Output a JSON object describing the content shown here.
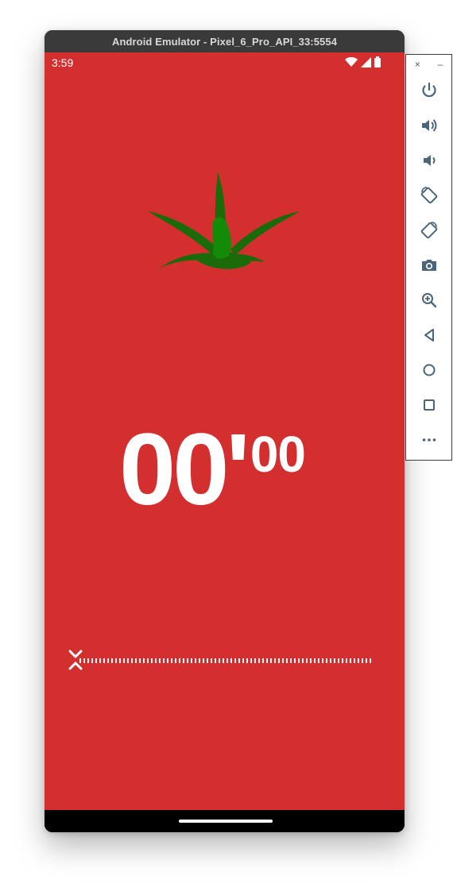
{
  "window": {
    "title": "Android Emulator - Pixel_6_Pro_API_33:5554"
  },
  "status_bar": {
    "time": "3:59",
    "icons": [
      "wifi-icon",
      "cellular-icon",
      "battery-icon"
    ]
  },
  "timer": {
    "minutes": "00'",
    "seconds": "00"
  },
  "colors": {
    "background": "#d32f2f",
    "stem": "#1b6b0b",
    "text": "#ffffff"
  },
  "toolbar": {
    "close_label": "×",
    "minimize_label": "–",
    "items": [
      "power-icon",
      "volume-up-icon",
      "volume-down-icon",
      "rotate-left-icon",
      "rotate-right-icon",
      "camera-icon",
      "zoom-icon",
      "back-icon",
      "home-icon",
      "overview-icon",
      "more-icon"
    ]
  }
}
